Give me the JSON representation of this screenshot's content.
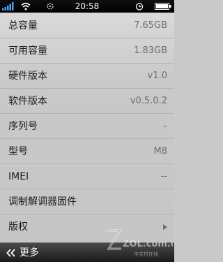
{
  "status_bar": {
    "time": "20:58",
    "icons": [
      "signal-icon",
      "wifi-icon",
      "sync-icon",
      "alarm-icon",
      "battery-icon"
    ]
  },
  "info_list": {
    "items": [
      {
        "label": "总容量",
        "value": "7.65GB"
      },
      {
        "label": "可用容量",
        "value": "1.83GB"
      },
      {
        "label": "硬件版本",
        "value": "v1.0"
      },
      {
        "label": "软件版本",
        "value": "v0.5.0.2"
      },
      {
        "label": "序列号",
        "value": "–"
      },
      {
        "label": "型号",
        "value": "M8"
      },
      {
        "label": "IMEI",
        "value": "--"
      },
      {
        "label": "调制解调器固件",
        "value": ""
      },
      {
        "label": "版权",
        "value": ""
      }
    ]
  },
  "bottom_bar": {
    "back_label": "更多"
  },
  "watermark": {
    "text": "ZOL.com.cn",
    "subtext": "中关村在线"
  },
  "colors": {
    "status_bar_bg": "#000000",
    "list_bg": "#c9c9c9",
    "label_text": "#1c1c1c",
    "value_text": "#6e6e6e",
    "bottom_bar_bg": "#2a2a2a"
  }
}
